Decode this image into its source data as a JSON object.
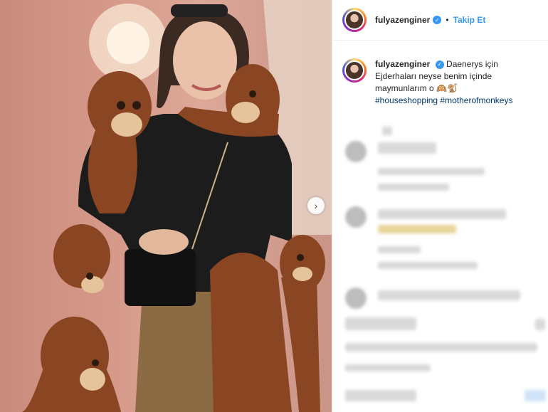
{
  "post": {
    "username": "fulyazenginer",
    "follow_label": "Takip Et",
    "separator": "•",
    "caption": {
      "line1": "Daenerys için",
      "line2": "Ejderhaları neyse benim içinde",
      "line3": "maymunlarım o",
      "emoji": "🙉🐒",
      "hashtag1": "#houseshopping",
      "hashtag2": "#motherofmonkeys"
    }
  },
  "icons": {
    "verified": "verified-badge-icon",
    "next": "chevron-right-icon"
  },
  "colors": {
    "accent": "#3897f0",
    "hashtag": "#00376b",
    "text": "#262626"
  }
}
